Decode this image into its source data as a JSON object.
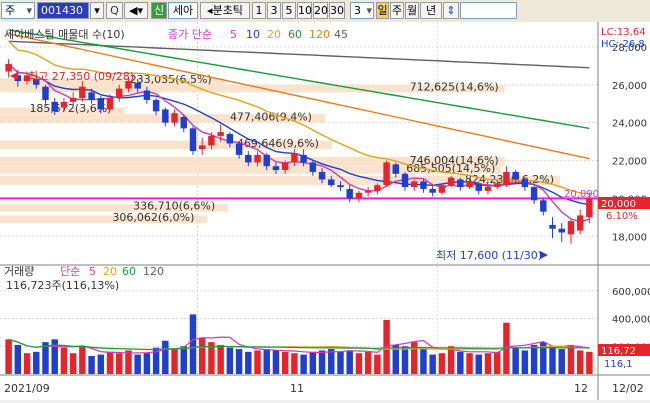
{
  "toolbar": {
    "market": "주",
    "code": "001430",
    "zoom_label": "Q",
    "trust_label": "신",
    "name": "세아",
    "mode_label": "◂분초틱",
    "periods": [
      "1",
      "3",
      "5",
      "10",
      "20",
      "30"
    ],
    "count": "3",
    "dropdown_label": "일",
    "frequency": "주",
    "unit": "월",
    "year_label": "년",
    "nav_label": "⇕"
  },
  "price_panel": {
    "title": "세아베스틸 매물대 수(10)",
    "ma_label": "종가 단순",
    "ma_periods": [
      "5",
      "10",
      "20",
      "60",
      "120",
      "45"
    ],
    "lc_label": "LC:13,64",
    "hc_label": "HC:-26,8",
    "high_annotation": "최고 27,350 (09/28)",
    "low_annotation": "최저 17,600 (11/30)",
    "current_price": "20,000",
    "current_change": "6.10%",
    "upper_ref": "20,090"
  },
  "volume_panel": {
    "title": "거래량",
    "ma_label": "단순",
    "ma_periods": [
      "5",
      "20",
      "60",
      "120"
    ],
    "summary": "116,723주(116,13%)",
    "current_vol_a": "116,72",
    "current_vol_b": "116,1"
  },
  "x_axis": {
    "labels": [
      "2021/09",
      "11",
      "12",
      "12/02"
    ]
  },
  "colors": {
    "up": "#e8232a",
    "down": "#1f3fd0",
    "ma5": "#d23ab5",
    "ma10": "#1f3fd0",
    "ma20": "#e0a318",
    "ma60": "#1b9a3a",
    "ma120": "#e87a1c",
    "ma45": "#606060",
    "profile": "#f9e3cc",
    "price_line": "#f21de0"
  },
  "chart_data": {
    "type": "candlestick",
    "price_axis": {
      "ticks": [
        28000,
        26000,
        24000,
        22000,
        20000,
        18000
      ],
      "ylim": [
        16800,
        29000
      ]
    },
    "volume_axis": {
      "ticks": [
        600000,
        400000,
        200000
      ],
      "ylim": [
        0,
        700000
      ]
    },
    "volume_profile": [
      {
        "label": "712,625(14,6%)",
        "low": 25600,
        "high": 26000,
        "share": 14.6
      },
      {
        "label": "233,035(6,5%)",
        "low": 26000,
        "high": 26350,
        "share": 6.5
      },
      {
        "label": "185,572(3,6%)",
        "low": 24450,
        "high": 24800,
        "share": 3.6
      },
      {
        "label": "477,406(9,4%)",
        "low": 24000,
        "high": 24450,
        "share": 9.4
      },
      {
        "label": "469,646(9,6%)",
        "low": 22600,
        "high": 23050,
        "share": 9.6
      },
      {
        "label": "746,004(14,6%)",
        "low": 21700,
        "high": 22200,
        "share": 14.6
      },
      {
        "label": "685,505(14,5%)",
        "low": 21300,
        "high": 21700,
        "share": 14.5
      },
      {
        "label": "824,238(16,2%)",
        "low": 20700,
        "high": 21200,
        "share": 16.2
      },
      {
        "label": "336,710(6,6%)",
        "low": 19300,
        "high": 19700,
        "share": 6.6
      },
      {
        "label": "306,062(6,0%)",
        "low": 18700,
        "high": 19100,
        "share": 6.0
      }
    ],
    "candles": [
      {
        "o": 26700,
        "c": 27100,
        "h": 27350,
        "l": 26400,
        "v": 250000
      },
      {
        "o": 26500,
        "c": 26200,
        "h": 26800,
        "l": 25900,
        "v": 210000
      },
      {
        "o": 26200,
        "c": 26500,
        "h": 26700,
        "l": 26000,
        "v": 150000
      },
      {
        "o": 26300,
        "c": 26000,
        "h": 26500,
        "l": 25800,
        "v": 160000
      },
      {
        "o": 25900,
        "c": 25200,
        "h": 26000,
        "l": 25000,
        "v": 230000
      },
      {
        "o": 25100,
        "c": 24600,
        "h": 25300,
        "l": 24400,
        "v": 250000
      },
      {
        "o": 24800,
        "c": 25100,
        "h": 25300,
        "l": 24600,
        "v": 190000
      },
      {
        "o": 25100,
        "c": 25300,
        "h": 25600,
        "l": 24900,
        "v": 150000
      },
      {
        "o": 25300,
        "c": 25900,
        "h": 26200,
        "l": 25100,
        "v": 200000
      },
      {
        "o": 25600,
        "c": 25200,
        "h": 25800,
        "l": 25000,
        "v": 130000
      },
      {
        "o": 25300,
        "c": 24700,
        "h": 25400,
        "l": 24500,
        "v": 140000
      },
      {
        "o": 24700,
        "c": 25300,
        "h": 25500,
        "l": 24600,
        "v": 160000
      },
      {
        "o": 25300,
        "c": 25800,
        "h": 26000,
        "l": 25100,
        "v": 150000
      },
      {
        "o": 25800,
        "c": 26200,
        "h": 26400,
        "l": 25600,
        "v": 170000
      },
      {
        "o": 26100,
        "c": 25800,
        "h": 26300,
        "l": 25600,
        "v": 140000
      },
      {
        "o": 25700,
        "c": 25200,
        "h": 25900,
        "l": 25000,
        "v": 150000
      },
      {
        "o": 25200,
        "c": 24600,
        "h": 25300,
        "l": 24400,
        "v": 190000
      },
      {
        "o": 24700,
        "c": 24000,
        "h": 24800,
        "l": 23800,
        "v": 240000
      },
      {
        "o": 24000,
        "c": 24500,
        "h": 24700,
        "l": 23800,
        "v": 180000
      },
      {
        "o": 24300,
        "c": 23700,
        "h": 24400,
        "l": 23500,
        "v": 200000
      },
      {
        "o": 23700,
        "c": 22500,
        "h": 23800,
        "l": 22300,
        "v": 430000
      },
      {
        "o": 22600,
        "c": 22800,
        "h": 23200,
        "l": 22300,
        "v": 260000
      },
      {
        "o": 22800,
        "c": 23300,
        "h": 23500,
        "l": 22600,
        "v": 230000
      },
      {
        "o": 23300,
        "c": 23500,
        "h": 23900,
        "l": 23000,
        "v": 210000
      },
      {
        "o": 23400,
        "c": 22900,
        "h": 23500,
        "l": 22700,
        "v": 190000
      },
      {
        "o": 22900,
        "c": 22300,
        "h": 23000,
        "l": 22100,
        "v": 180000
      },
      {
        "o": 22300,
        "c": 21900,
        "h": 22500,
        "l": 21700,
        "v": 160000
      },
      {
        "o": 21900,
        "c": 22300,
        "h": 22500,
        "l": 21700,
        "v": 170000
      },
      {
        "o": 22300,
        "c": 21700,
        "h": 22400,
        "l": 21500,
        "v": 180000
      },
      {
        "o": 21700,
        "c": 21500,
        "h": 21900,
        "l": 21300,
        "v": 170000
      },
      {
        "o": 21500,
        "c": 21900,
        "h": 22000,
        "l": 21300,
        "v": 160000
      },
      {
        "o": 21900,
        "c": 22400,
        "h": 22600,
        "l": 21700,
        "v": 150000
      },
      {
        "o": 22300,
        "c": 21900,
        "h": 22600,
        "l": 21700,
        "v": 140000
      },
      {
        "o": 21900,
        "c": 21400,
        "h": 22000,
        "l": 21200,
        "v": 160000
      },
      {
        "o": 21400,
        "c": 21000,
        "h": 21600,
        "l": 20800,
        "v": 170000
      },
      {
        "o": 21000,
        "c": 20700,
        "h": 21200,
        "l": 20600,
        "v": 180000
      },
      {
        "o": 20700,
        "c": 20600,
        "h": 20900,
        "l": 20400,
        "v": 160000
      },
      {
        "o": 20500,
        "c": 20000,
        "h": 20700,
        "l": 19800,
        "v": 170000
      },
      {
        "o": 20000,
        "c": 20300,
        "h": 20400,
        "l": 19800,
        "v": 150000
      },
      {
        "o": 20300,
        "c": 20400,
        "h": 20600,
        "l": 20100,
        "v": 160000
      },
      {
        "o": 20400,
        "c": 20700,
        "h": 20800,
        "l": 20200,
        "v": 140000
      },
      {
        "o": 20700,
        "c": 21900,
        "h": 22000,
        "l": 20600,
        "v": 390000
      },
      {
        "o": 21800,
        "c": 21300,
        "h": 21900,
        "l": 21100,
        "v": 210000
      },
      {
        "o": 21300,
        "c": 20600,
        "h": 21400,
        "l": 20400,
        "v": 200000
      },
      {
        "o": 20600,
        "c": 20900,
        "h": 21000,
        "l": 20400,
        "v": 230000
      },
      {
        "o": 20900,
        "c": 20500,
        "h": 21000,
        "l": 20300,
        "v": 180000
      },
      {
        "o": 20500,
        "c": 20300,
        "h": 20700,
        "l": 20100,
        "v": 140000
      },
      {
        "o": 20300,
        "c": 20700,
        "h": 20800,
        "l": 20200,
        "v": 150000
      },
      {
        "o": 20700,
        "c": 21100,
        "h": 21200,
        "l": 20600,
        "v": 200000
      },
      {
        "o": 21000,
        "c": 20600,
        "h": 21100,
        "l": 20400,
        "v": 160000
      },
      {
        "o": 20600,
        "c": 20900,
        "h": 21000,
        "l": 20500,
        "v": 150000
      },
      {
        "o": 20800,
        "c": 20400,
        "h": 20900,
        "l": 20200,
        "v": 140000
      },
      {
        "o": 20400,
        "c": 20600,
        "h": 20700,
        "l": 20200,
        "v": 150000
      },
      {
        "o": 20600,
        "c": 20800,
        "h": 21000,
        "l": 20500,
        "v": 160000
      },
      {
        "o": 20700,
        "c": 21400,
        "h": 21700,
        "l": 20600,
        "v": 370000
      },
      {
        "o": 21400,
        "c": 21000,
        "h": 21500,
        "l": 20800,
        "v": 190000
      },
      {
        "o": 21000,
        "c": 20600,
        "h": 21100,
        "l": 20400,
        "v": 170000
      },
      {
        "o": 20600,
        "c": 19900,
        "h": 20700,
        "l": 19700,
        "v": 210000
      },
      {
        "o": 19900,
        "c": 19300,
        "h": 20000,
        "l": 19100,
        "v": 230000
      },
      {
        "o": 18600,
        "c": 18400,
        "h": 19000,
        "l": 17900,
        "v": 200000
      },
      {
        "o": 18400,
        "c": 18200,
        "h": 18700,
        "l": 17700,
        "v": 180000
      },
      {
        "o": 18100,
        "c": 18800,
        "h": 18900,
        "l": 17600,
        "v": 210000
      },
      {
        "o": 18300,
        "c": 19100,
        "h": 19400,
        "l": 18100,
        "v": 170000
      },
      {
        "o": 19000,
        "c": 20000,
        "h": 20300,
        "l": 18700,
        "v": 160000
      }
    ]
  }
}
